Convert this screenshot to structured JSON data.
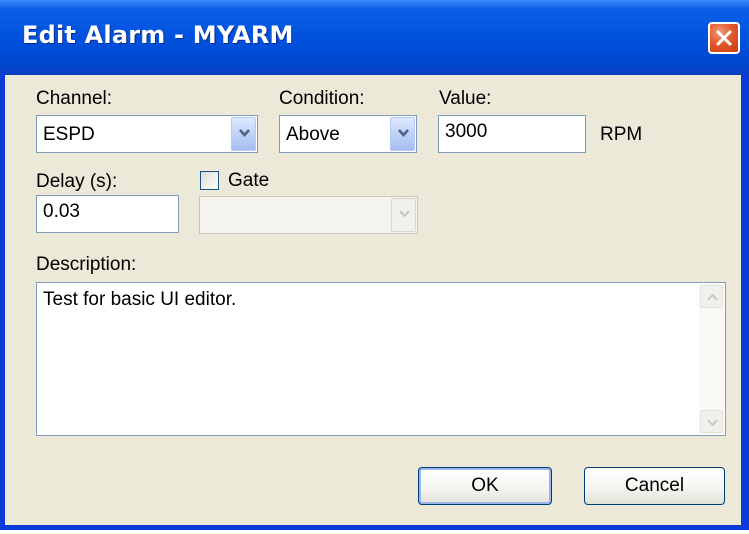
{
  "dialog": {
    "title": "Edit Alarm - MYARM"
  },
  "icons": {
    "close": "close-icon",
    "dropdown": "chevron-down-icon",
    "scroll_up": "scroll-up-arrow-icon",
    "scroll_down": "scroll-down-arrow-icon"
  },
  "colors": {
    "titlebar": "#0054e3",
    "close_button": "#e35a2e",
    "dialog_background": "#ece9d8",
    "field_border": "#7f9db9",
    "button_border": "#003c74"
  },
  "form": {
    "channel": {
      "label": "Channel:",
      "value": "ESPD"
    },
    "condition": {
      "label": "Condition:",
      "value": "Above"
    },
    "value": {
      "label": "Value:",
      "value": "3000",
      "unit": "RPM"
    },
    "delay": {
      "label": "Delay (s):",
      "value": "0.03"
    },
    "gate": {
      "label": "Gate",
      "checked": false,
      "value": ""
    },
    "description": {
      "label": "Description:",
      "value": "Test for basic UI editor."
    }
  },
  "buttons": {
    "ok": "OK",
    "cancel": "Cancel"
  }
}
